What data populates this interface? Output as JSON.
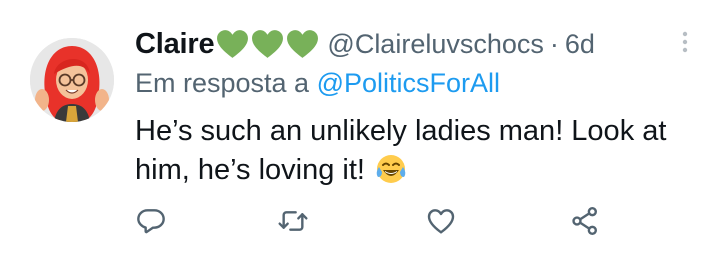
{
  "tweet": {
    "display_name": "Claire",
    "name_emoji": "green-heart-icon",
    "handle": "@Claireluvschocs",
    "separator": "·",
    "time": "6d",
    "reply_prefix": "Em resposta a",
    "reply_to": "@PoliticsForAll",
    "text": "He’s such an unlikely ladies man! Look at him, he’s loving it!",
    "text_emoji": "tears-of-joy-emoji"
  },
  "actions": [
    {
      "name": "reply",
      "icon": "comment-icon"
    },
    {
      "name": "retweet",
      "icon": "retweet-icon"
    },
    {
      "name": "like",
      "icon": "heart-icon"
    },
    {
      "name": "share",
      "icon": "share-icon"
    }
  ],
  "colors": {
    "text": "#0f1419",
    "secondary": "#536471",
    "link": "#1d9bf0",
    "heart_green": "#78b159",
    "avatar_hair": "#e8322a"
  }
}
